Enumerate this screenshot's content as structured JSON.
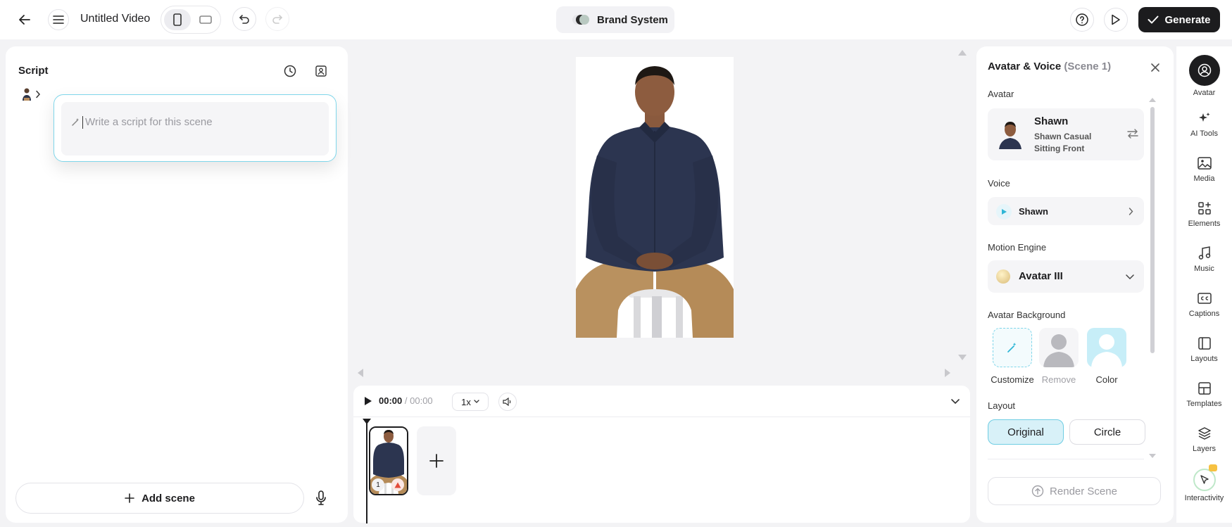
{
  "header": {
    "title": "Untitled Video",
    "brand_label": "Brand System",
    "generate_label": "Generate"
  },
  "script_panel": {
    "title": "Script",
    "placeholder": "Write a script for this scene",
    "add_scene_label": "Add scene"
  },
  "playback": {
    "current_time": "00:00",
    "separator": "/",
    "total_time": "00:00",
    "speed": "1x"
  },
  "timeline": {
    "scene_number": "1"
  },
  "avatar_panel": {
    "title": "Avatar & Voice",
    "scene_label": "(Scene 1)",
    "avatar_section_label": "Avatar",
    "avatar_name": "Shawn",
    "avatar_look_line1": "Shawn Casual",
    "avatar_look_line2": "Sitting Front",
    "voice_section_label": "Voice",
    "voice_name": "Shawn",
    "motion_section_label": "Motion Engine",
    "motion_value": "Avatar III",
    "background_section_label": "Avatar Background",
    "background_options": [
      "Customize",
      "Remove",
      "Color"
    ],
    "layout_section_label": "Layout",
    "layout_options": [
      "Original",
      "Circle"
    ],
    "render_label": "Render Scene"
  },
  "rail": {
    "items": [
      "Avatar",
      "AI Tools",
      "Media",
      "Elements",
      "Music",
      "Captions",
      "Layouts",
      "Templates",
      "Layers",
      "Interactivity"
    ]
  },
  "colors": {
    "accent": "#5cc8e0",
    "dark": "#1d1d1f",
    "selected_bg": "#d8f1f8"
  }
}
